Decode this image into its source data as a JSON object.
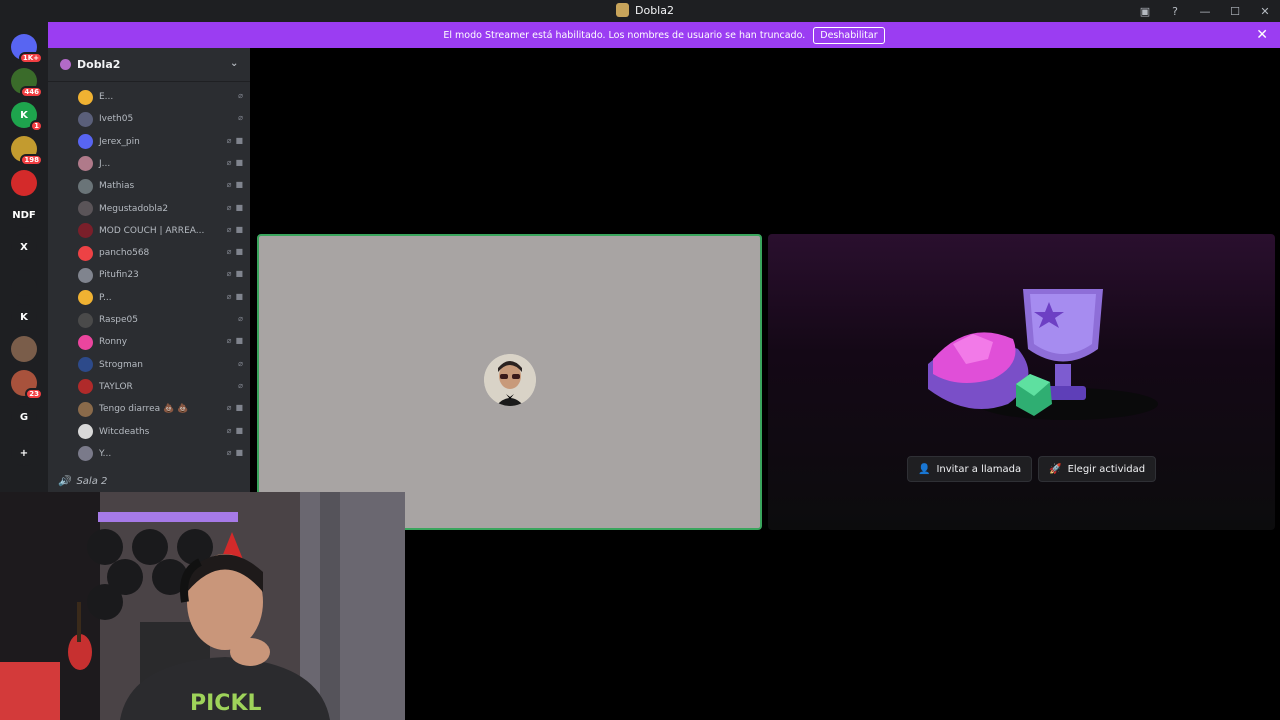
{
  "window": {
    "title": "Dobla2"
  },
  "banner": {
    "text": "El modo Streamer está habilitado. Los nombres de usuario se han truncado.",
    "button_label": "Deshabilitar",
    "color": "#9b3df2"
  },
  "guilds": [
    {
      "label": "",
      "badge": "1K+",
      "color": "#5865f2"
    },
    {
      "label": "",
      "badge": "446",
      "color": "#3a6b2a"
    },
    {
      "label": "K",
      "badge": "1",
      "color": "#1ea44d"
    },
    {
      "label": "",
      "badge": "198",
      "color": "#c39b2f"
    },
    {
      "label": "",
      "badge": "",
      "color": "#d42a2a"
    },
    {
      "label": "NDF",
      "badge": "",
      "color": "#1e1f22"
    },
    {
      "label": "X",
      "badge": "",
      "color": "#1e1f22"
    },
    {
      "label": "",
      "badge": "",
      "color": "#1e1f22"
    },
    {
      "label": "K",
      "badge": "",
      "color": "#1e1f22"
    },
    {
      "label": "",
      "badge": "",
      "color": "#7a5d4a"
    },
    {
      "label": "",
      "badge": "23",
      "color": "#a8523c"
    },
    {
      "label": "G",
      "badge": "",
      "color": "#1e1f22"
    },
    {
      "label": "+",
      "badge": "",
      "color": "#1e1f22"
    }
  ],
  "sidebar": {
    "server_name": "Dobla2",
    "members": [
      {
        "name": "E...",
        "color": "#f0b232",
        "cam": false
      },
      {
        "name": "Iveth05",
        "color": "#5a5f7a",
        "cam": false
      },
      {
        "name": "Jerex_pin",
        "color": "#5865f2",
        "cam": true
      },
      {
        "name": "J...",
        "color": "#b07a8a",
        "cam": true
      },
      {
        "name": "Mathias",
        "color": "#6a7478",
        "cam": true
      },
      {
        "name": "Megustadobla2",
        "color": "#5a5458",
        "cam": true
      },
      {
        "name": "MOD COUCH | ARREA...",
        "color": "#7a1f2a",
        "cam": true
      },
      {
        "name": "pancho568",
        "color": "#ed4245",
        "cam": true
      },
      {
        "name": "Pitufin23",
        "color": "#80848e",
        "cam": true
      },
      {
        "name": "P...",
        "color": "#f0b232",
        "cam": true
      },
      {
        "name": "Raspe05",
        "color": "#4a4a4a",
        "cam": false
      },
      {
        "name": "Ronny",
        "color": "#eb459e",
        "cam": true
      },
      {
        "name": "Strogman",
        "color": "#2d4a8a",
        "cam": false
      },
      {
        "name": "TAYLOR",
        "color": "#b02a2a",
        "cam": false
      },
      {
        "name": "Tengo diarrea 💩 💩",
        "color": "#8a6a4a",
        "cam": true
      },
      {
        "name": "Witcdeaths",
        "color": "#d8d8d8",
        "cam": true
      },
      {
        "name": "Y...",
        "color": "#7a7a8a",
        "cam": true
      }
    ],
    "channel": "Sala 2"
  },
  "activity": {
    "invite_label": "Invitar a llamada",
    "activity_label": "Elegir actividad"
  }
}
